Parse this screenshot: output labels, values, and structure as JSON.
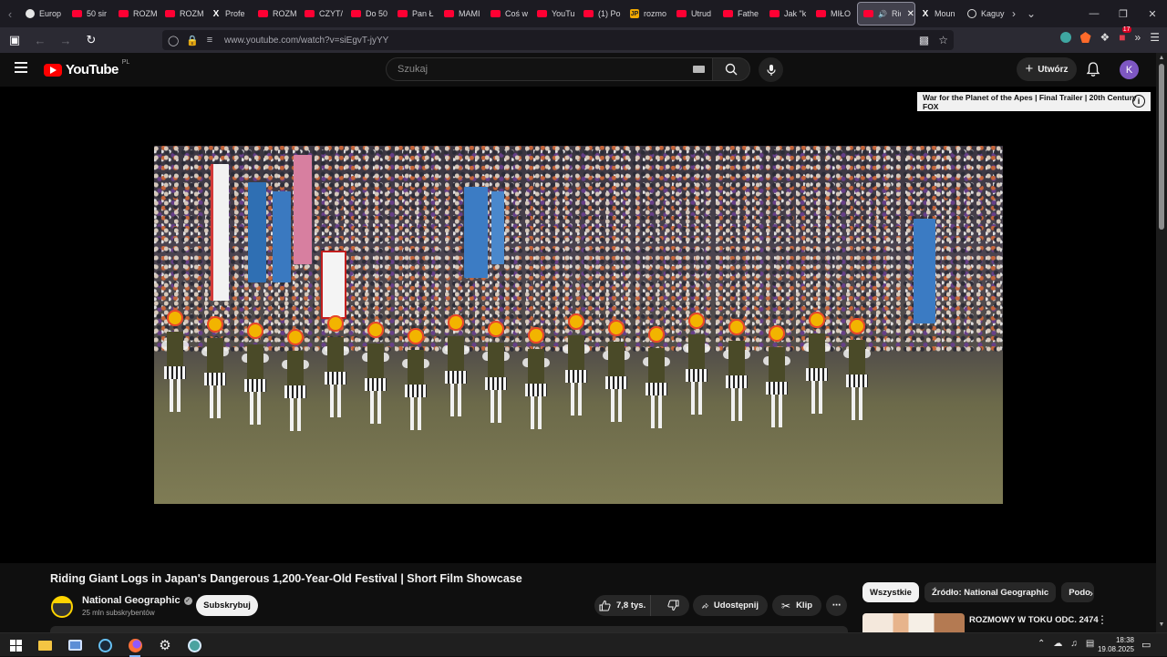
{
  "browser": {
    "tabs": [
      {
        "label": "Europ",
        "favicon": "globe"
      },
      {
        "label": "50 sir",
        "favicon": "youtube"
      },
      {
        "label": "ROZM",
        "favicon": "youtube"
      },
      {
        "label": "ROZM",
        "favicon": "youtube"
      },
      {
        "label": "Profe",
        "favicon": "x"
      },
      {
        "label": "ROZM",
        "favicon": "youtube"
      },
      {
        "label": "CZYT/",
        "favicon": "youtube"
      },
      {
        "label": "Do 50",
        "favicon": "youtube"
      },
      {
        "label": "Pan Ł",
        "favicon": "youtube"
      },
      {
        "label": "MAMI",
        "favicon": "youtube"
      },
      {
        "label": "Coś w",
        "favicon": "youtube"
      },
      {
        "label": "YouTu",
        "favicon": "youtube"
      },
      {
        "label": "(1) Po",
        "favicon": "youtube"
      },
      {
        "label": "rozmo",
        "favicon": "jp"
      },
      {
        "label": "Utrud",
        "favicon": "youtube"
      },
      {
        "label": "Fathe",
        "favicon": "youtube"
      },
      {
        "label": "Jak \"k",
        "favicon": "youtube"
      },
      {
        "label": "MIŁO",
        "favicon": "youtube"
      },
      {
        "label": "Rid",
        "favicon": "youtube",
        "active": true
      },
      {
        "label": "Moun",
        "favicon": "x"
      },
      {
        "label": "Kaguy",
        "favicon": "kaguya"
      }
    ],
    "url": "www.youtube.com/watch?v=siEgvT-jyYY",
    "extension_badge": "17"
  },
  "youtube": {
    "logo_word": "YouTube",
    "country_code": "PL",
    "search_placeholder": "Szukaj",
    "create_label": "Utwórz",
    "avatar_letter": "K",
    "ad_title": "War for the Planet of the Apes | Final Trailer | 20th Century FOX",
    "video": {
      "title": "Riding Giant Logs in Japan's Dangerous 1,200-Year-Old Festival | Short Film Showcase",
      "channel": "National Geographic",
      "subscribers": "25 mln subskrybentów",
      "subscribe_label": "Subskrybuj",
      "likes": "7,8 tys.",
      "share_label": "Udostępnij",
      "clip_label": "Klip"
    },
    "filter_chips": [
      {
        "label": "Wszystkie",
        "selected": true
      },
      {
        "label": "Źródło: National Geographic",
        "selected": false
      },
      {
        "label": "Podo",
        "selected": false
      }
    ],
    "recommendation": {
      "title": "ROZMOWY W TOKU ODC. 2474"
    }
  },
  "taskbar": {
    "time": "18:38",
    "date": "19.08.2025"
  },
  "colors": {
    "youtube_red": "#ff0000",
    "background": "#0f0f0f",
    "avatar": "#7e57c2"
  }
}
